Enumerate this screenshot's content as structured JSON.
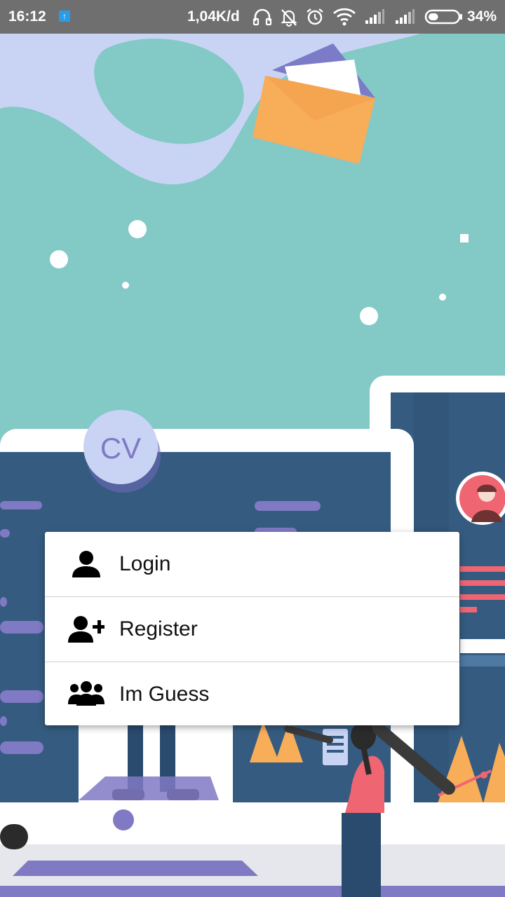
{
  "status_bar": {
    "time": "16:12",
    "upload_indicator": "↑",
    "network_speed": "1,04K/d",
    "battery_percent": "34%",
    "battery_level": 0.34,
    "icons": [
      "upload-notification-icon",
      "headset-icon",
      "bell-off-icon",
      "alarm-icon",
      "wifi-icon",
      "signal-icon",
      "signal-icon",
      "battery-icon"
    ]
  },
  "illustration": {
    "cv_badge": "CV"
  },
  "menu": {
    "items": [
      {
        "label": "Login",
        "icon": "person-icon"
      },
      {
        "label": "Register",
        "icon": "person-add-icon"
      },
      {
        "label": "Im Guess",
        "icon": "group-icon"
      }
    ]
  },
  "colors": {
    "teal_background": "#83c9c6",
    "lavender": "#c9d4f5",
    "navy_screen": "#355c80",
    "purple_accent": "#8079c4",
    "orange_accent": "#f8ad59",
    "pink_accent": "#f06572",
    "status_bar": "#6f6f6f"
  }
}
